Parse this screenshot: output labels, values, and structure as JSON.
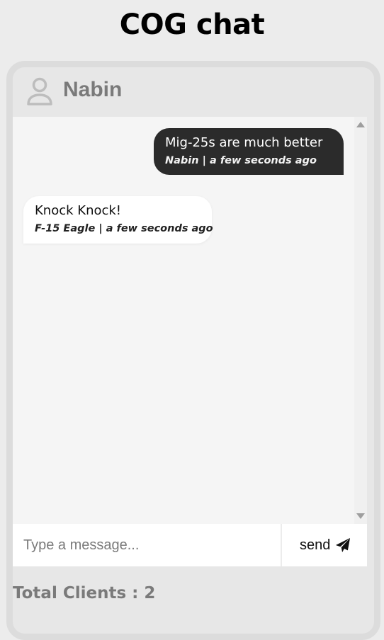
{
  "app": {
    "title": "COG chat"
  },
  "header": {
    "user_name": "Nabin",
    "icon": "user-icon"
  },
  "messages": [
    {
      "direction": "outgoing",
      "text": "Mig-25s are much better",
      "meta": "Nabin | a few seconds ago",
      "bg_color": "#2b2b2b"
    },
    {
      "direction": "incoming",
      "text": "Knock Knock!",
      "meta": "F-15 Eagle | a few seconds ago",
      "bg_color": "#ffffff"
    }
  ],
  "composer": {
    "placeholder": "Type a message...",
    "value": "",
    "send_label": "send",
    "send_icon": "paper-plane-icon"
  },
  "footer": {
    "total_clients": "Total Clients : 2"
  }
}
